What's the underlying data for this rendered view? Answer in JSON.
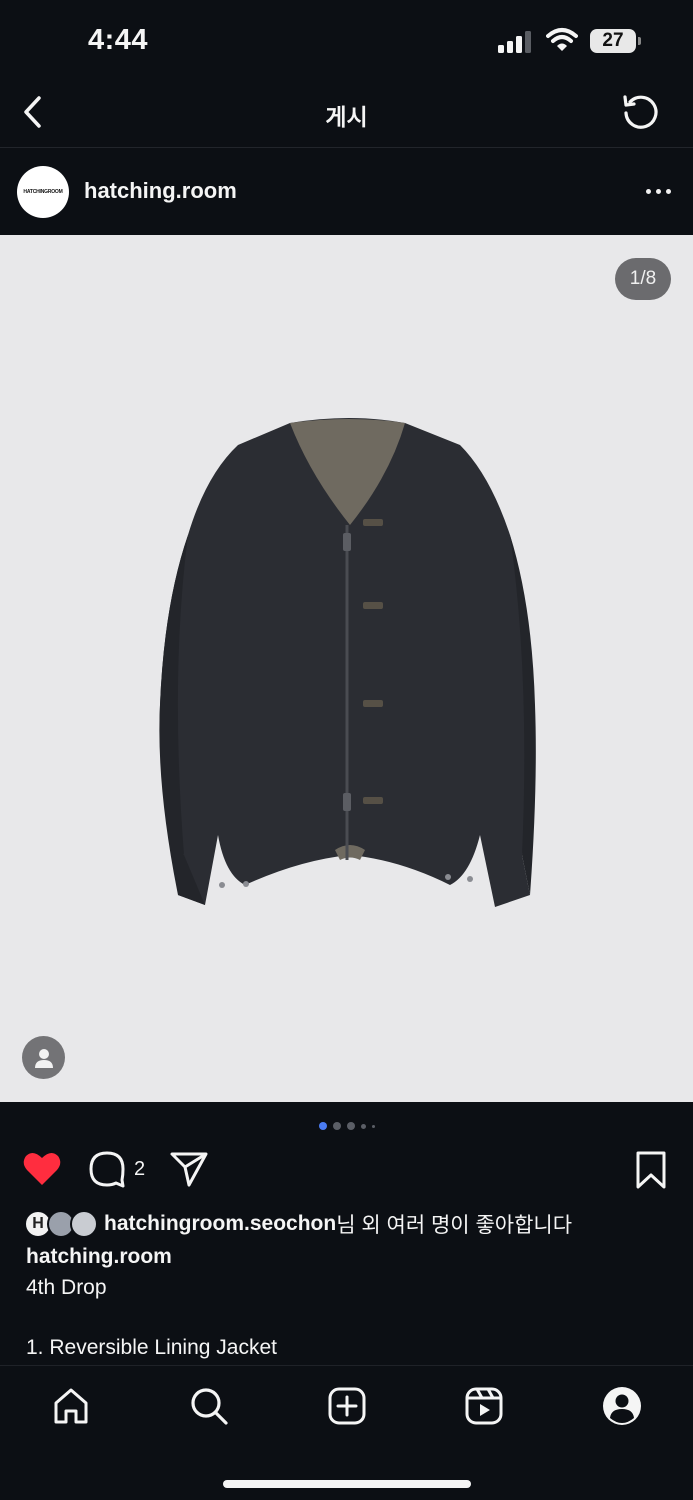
{
  "status_bar": {
    "time": "4:44",
    "battery": "27"
  },
  "nav": {
    "title": "게시"
  },
  "post": {
    "username": "hatching.room",
    "avatar_text": "HATCHINGROOM",
    "page_counter": "1/8",
    "carousel": {
      "current": 1,
      "total": 8
    },
    "comment_count": "2",
    "liked": true,
    "likes": {
      "avatar_letter": "H",
      "user": "hatchingroom.seochon",
      "rest": "님 외 여러 명이 좋아합니다"
    },
    "caption": {
      "user": "hatching.room",
      "line1": "4th Drop",
      "line2": "1. Reversible Lining Jacket"
    }
  },
  "colors": {
    "background": "#0c0f14",
    "image_background": "#e8e8ea",
    "heart": "#ff2d3f",
    "carousel_active": "#4b7cf2"
  },
  "icons": {
    "back": "chevron-left-icon",
    "refresh": "refresh-icon",
    "more": "more-horizontal-icon",
    "heart": "heart-icon",
    "comment": "comment-icon",
    "share": "send-icon",
    "bookmark": "bookmark-icon",
    "tabs": [
      "home-icon",
      "search-icon",
      "create-icon",
      "reels-icon",
      "profile-icon"
    ]
  }
}
